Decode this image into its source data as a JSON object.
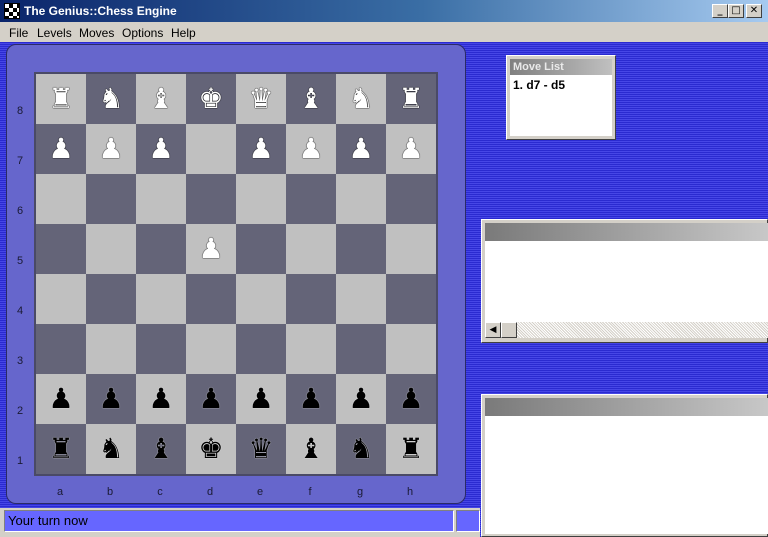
{
  "window": {
    "title": "The Genius::Chess Engine",
    "controls": {
      "minimize": "_",
      "maximize": "□",
      "close": "✕"
    }
  },
  "menu": [
    "File",
    "Levels",
    "Moves",
    "Options",
    "Help"
  ],
  "board": {
    "ranks": [
      "8",
      "7",
      "6",
      "5",
      "4",
      "3",
      "2",
      "1"
    ],
    "files": [
      "a",
      "b",
      "c",
      "d",
      "e",
      "f",
      "g",
      "h"
    ],
    "white_pieces": {
      "rank8": [
        "♜",
        "♞",
        "♝",
        "♚",
        "♛",
        "♝",
        "♞",
        "♜"
      ],
      "rank7": [
        "♟",
        "♟",
        "♟",
        "",
        "♟",
        "♟",
        "♟",
        "♟"
      ],
      "rank5_d": "♟"
    },
    "black_pieces": {
      "rank2": [
        "♟",
        "♟",
        "♟",
        "♟",
        "♟",
        "♟",
        "♟",
        "♟"
      ],
      "rank1": [
        "♜",
        "♞",
        "♝",
        "♚",
        "♛",
        "♝",
        "♞",
        "♜"
      ]
    }
  },
  "move_list": {
    "title": "Move List",
    "moves": [
      "1. d7 - d5"
    ]
  },
  "status": {
    "message": "Your turn now"
  },
  "colors": {
    "light_square": "#c0c0c0",
    "dark_square": "#646478",
    "board_panel": "#6666cc",
    "background": "#3636d8",
    "status_bar": "#6666ff"
  }
}
